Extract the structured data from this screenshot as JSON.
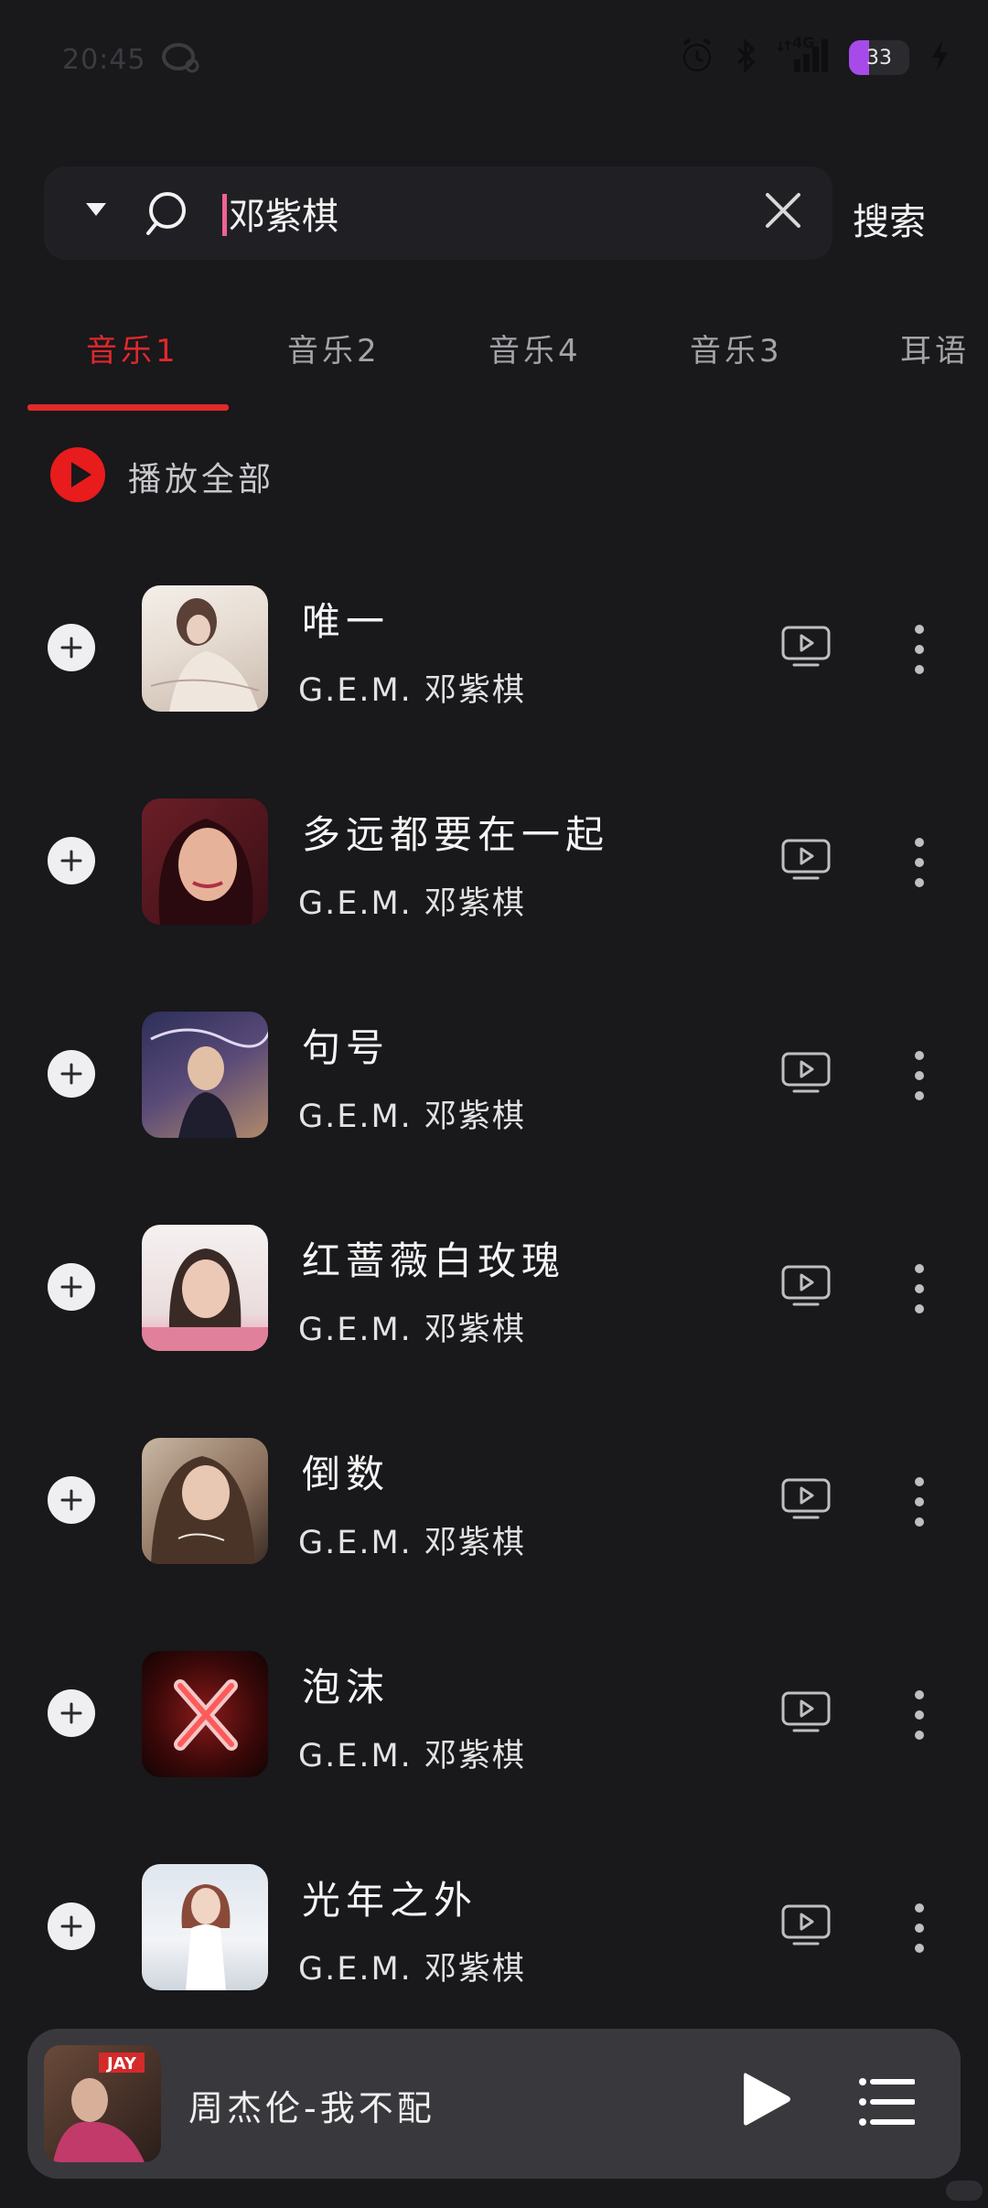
{
  "status_bar": {
    "time": "20:45",
    "network": "4G",
    "battery": "33",
    "battery_level": 0.33
  },
  "search": {
    "query": "邓紫棋",
    "button_label": "搜索"
  },
  "tabs": [
    {
      "label": "音乐1",
      "active": true
    },
    {
      "label": "音乐2",
      "active": false
    },
    {
      "label": "音乐4",
      "active": false
    },
    {
      "label": "音乐3",
      "active": false
    },
    {
      "label": "耳语",
      "active": false
    }
  ],
  "play_all": {
    "label": "播放全部"
  },
  "songs": [
    {
      "title": "唯一",
      "artist": "G.E.M. 邓紫棋"
    },
    {
      "title": "多远都要在一起",
      "artist": "G.E.M. 邓紫棋"
    },
    {
      "title": "句号",
      "artist": "G.E.M. 邓紫棋"
    },
    {
      "title": "红蔷薇白玫瑰",
      "artist": "G.E.M. 邓紫棋"
    },
    {
      "title": "倒数",
      "artist": "G.E.M. 邓紫棋"
    },
    {
      "title": "泡沫",
      "artist": "G.E.M. 邓紫棋"
    },
    {
      "title": "光年之外",
      "artist": "G.E.M. 邓紫棋"
    }
  ],
  "now_playing": {
    "title": "周杰伦-我不配",
    "album_badge": "JAY"
  },
  "colors": {
    "background": "#19181b",
    "accent": "#e12a2a",
    "player_bg": "#39393d",
    "battery": "#a64bea"
  }
}
